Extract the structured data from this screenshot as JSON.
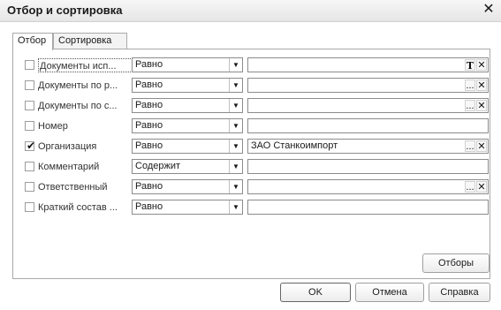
{
  "window": {
    "title": "Отбор и сортировка",
    "close_glyph": "✕"
  },
  "tabs": [
    {
      "label": "Отбор",
      "active": true
    },
    {
      "label": "Сортировка",
      "active": false
    }
  ],
  "filters": [
    {
      "name": "Документы исп...",
      "checked": false,
      "condition": "Равно",
      "value": "",
      "buttons": [
        "T",
        "✕"
      ],
      "focused": true
    },
    {
      "name": "Документы по р...",
      "checked": false,
      "condition": "Равно",
      "value": "",
      "buttons": [
        "...",
        "✕"
      ]
    },
    {
      "name": "Документы по с...",
      "checked": false,
      "condition": "Равно",
      "value": "",
      "buttons": [
        "...",
        "✕"
      ]
    },
    {
      "name": "Номер",
      "checked": false,
      "condition": "Равно",
      "value": "",
      "buttons": []
    },
    {
      "name": "Организация",
      "checked": true,
      "condition": "Равно",
      "value": "ЗАО Станкоимпорт",
      "buttons": [
        "...",
        "✕"
      ]
    },
    {
      "name": "Комментарий",
      "checked": false,
      "condition": "Содержит",
      "value": "",
      "buttons": []
    },
    {
      "name": "Ответственный",
      "checked": false,
      "condition": "Равно",
      "value": "",
      "buttons": [
        "...",
        "✕"
      ]
    },
    {
      "name": "Краткий состав ...",
      "checked": false,
      "condition": "Равно",
      "value": "",
      "buttons": []
    }
  ],
  "dropdown_arrow": "▼",
  "check_glyph": "✔",
  "buttons": {
    "filters": "Отборы",
    "ok": "OK",
    "cancel": "Отмена",
    "help": "Справка"
  }
}
